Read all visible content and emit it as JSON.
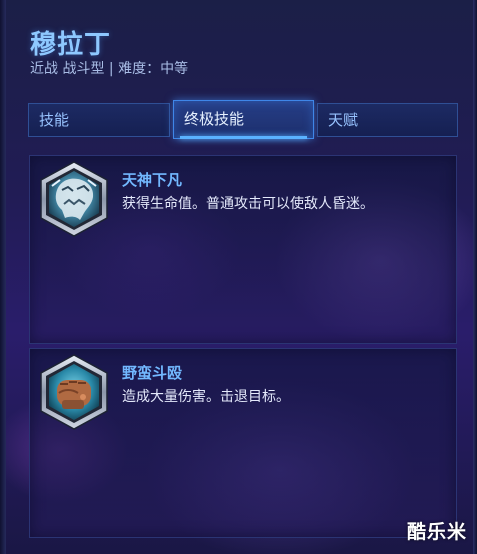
{
  "hero": {
    "name": "穆拉丁",
    "subtitle": "近战 战斗型 | 难度：中等"
  },
  "tabs": [
    {
      "label": "技能",
      "active": false
    },
    {
      "label": "终极技能",
      "active": true
    },
    {
      "label": "天赋",
      "active": false
    }
  ],
  "abilities": [
    {
      "name": "天神下凡",
      "description": "获得生命值。普通攻击可以使敌人昏迷。",
      "icon": "avatar-icon"
    },
    {
      "name": "野蛮斗殴",
      "description": "造成大量伤害。击退目标。",
      "icon": "fist-icon"
    }
  ],
  "watermark": "酷乐米",
  "colors": {
    "accent": "#72b8ff",
    "title": "#8ec8ff",
    "tab_active_border": "#3f86e8"
  }
}
